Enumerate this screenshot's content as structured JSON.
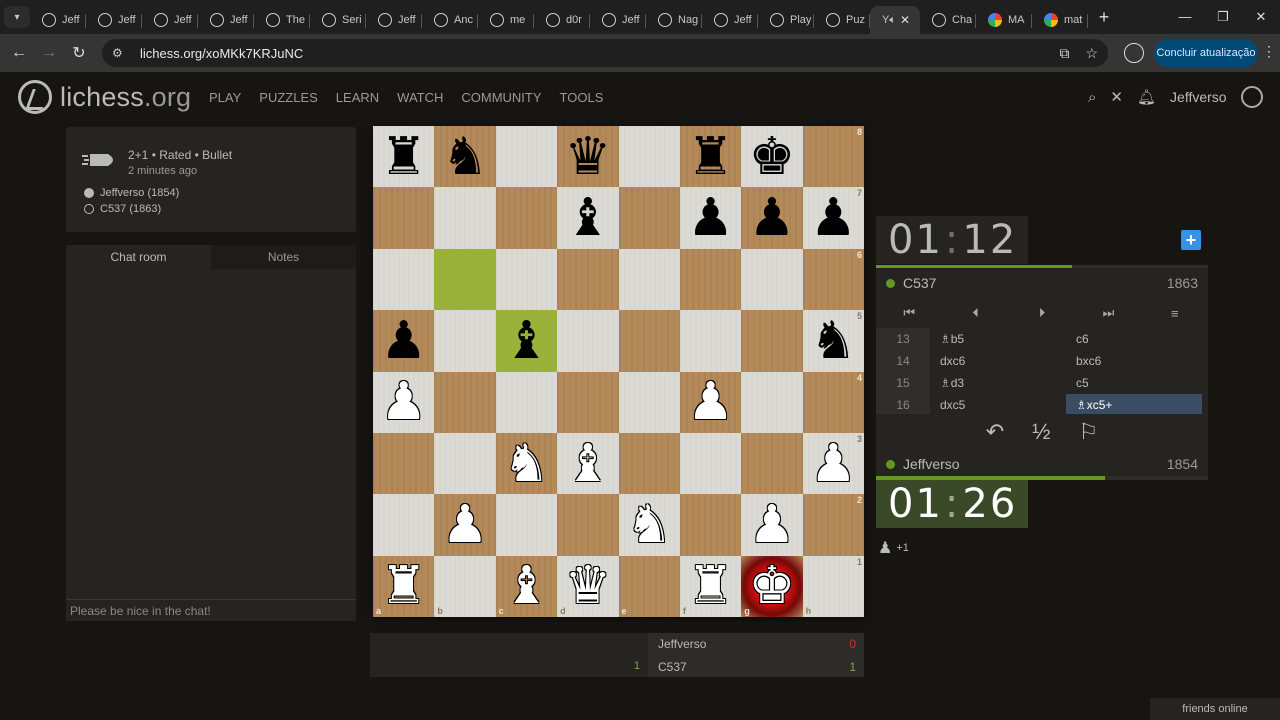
{
  "browser": {
    "tabs": [
      {
        "label": "Jeff",
        "icon": "lichess"
      },
      {
        "label": "Jeff",
        "icon": "lichess"
      },
      {
        "label": "Jeff",
        "icon": "lichess"
      },
      {
        "label": "Jeff",
        "icon": "lichess"
      },
      {
        "label": "The",
        "icon": "lichess"
      },
      {
        "label": "Seri",
        "icon": "lichess"
      },
      {
        "label": "Jeff",
        "icon": "lichess"
      },
      {
        "label": "Anc",
        "icon": "lichess"
      },
      {
        "label": "me",
        "icon": "lichess"
      },
      {
        "label": "d0r",
        "icon": "lichess"
      },
      {
        "label": "Jeff",
        "icon": "lichess"
      },
      {
        "label": "Nag",
        "icon": "lichess"
      },
      {
        "label": "Jeff",
        "icon": "lichess"
      },
      {
        "label": "Play",
        "icon": "lichess"
      },
      {
        "label": "Puz",
        "icon": "lichess"
      }
    ],
    "active_tab": {
      "label": "Y"
    },
    "tabs_after": [
      {
        "label": "Cha",
        "icon": "chatgpt"
      },
      {
        "label": "MA",
        "icon": "google"
      },
      {
        "label": "mat",
        "icon": "google"
      }
    ],
    "url": "lichess.org/xoMKk7KRJuNC",
    "update_label": "Concluir atualização"
  },
  "site": {
    "logo_main": "lichess",
    "logo_tld": ".org",
    "nav": [
      "PLAY",
      "PUZZLES",
      "LEARN",
      "WATCH",
      "COMMUNITY",
      "TOOLS"
    ],
    "username": "Jeffverso"
  },
  "game": {
    "setup": "2+1 • Rated • Bullet",
    "when": "2 minutes ago",
    "white_player": "Jeffverso (1854)",
    "black_player": "C537 (1863)"
  },
  "chat": {
    "tab_chat": "Chat room",
    "tab_notes": "Notes",
    "placeholder": "Please be nice in the chat!"
  },
  "board": {
    "ranks": [
      "8",
      "7",
      "6",
      "5",
      "4",
      "3",
      "2",
      "1"
    ],
    "files": [
      "a",
      "b",
      "c",
      "d",
      "e",
      "f",
      "g",
      "h"
    ],
    "position": [
      [
        "r",
        "n",
        "",
        "q",
        "",
        "r",
        "k",
        ""
      ],
      [
        "",
        "",
        "",
        "b",
        "",
        "p",
        "p",
        "p"
      ],
      [
        "",
        "",
        "",
        "",
        "",
        "",
        "",
        ""
      ],
      [
        "p",
        "",
        "b",
        "",
        "",
        "",
        "",
        "n"
      ],
      [
        "P",
        "",
        "",
        "",
        "",
        "P",
        "",
        ""
      ],
      [
        "",
        "",
        "N",
        "B",
        "",
        "",
        "",
        "P"
      ],
      [
        "",
        "P",
        "",
        "",
        "N",
        "",
        "P",
        ""
      ],
      [
        "R",
        "",
        "B",
        "Q",
        "",
        "R",
        "K",
        ""
      ]
    ],
    "highlights": [
      "b6",
      "c5"
    ],
    "check_square": "g1"
  },
  "material": {
    "left_score": "1",
    "rows": [
      {
        "name": "Jeffverso",
        "score": "0"
      },
      {
        "name": "C537",
        "score": "1"
      }
    ]
  },
  "clocks": {
    "top": {
      "min": "01",
      "sec": "12"
    },
    "bottom": {
      "min": "01",
      "sec": "26"
    },
    "top_fraction": 0.59,
    "bottom_fraction": 0.69
  },
  "players": {
    "top": {
      "name": "C537",
      "rating": "1863"
    },
    "bottom": {
      "name": "Jeffverso",
      "rating": "1854"
    }
  },
  "moves": [
    {
      "n": "13",
      "w": "♗b5",
      "b": "c6"
    },
    {
      "n": "14",
      "w": "dxc6",
      "b": "bxc6"
    },
    {
      "n": "15",
      "w": "♗d3",
      "b": "c5"
    },
    {
      "n": "16",
      "w": "dxc5",
      "b": "♗xc5+"
    }
  ],
  "actions": {
    "draw_label": "½"
  },
  "spectators": "+1",
  "friends_online": "friends online",
  "colors": {
    "accent_green": "#629924",
    "highlight": "#9bb23a",
    "check_red": "#d01010",
    "current_move": "#3a4c63",
    "blue_button": "#3692e7"
  }
}
